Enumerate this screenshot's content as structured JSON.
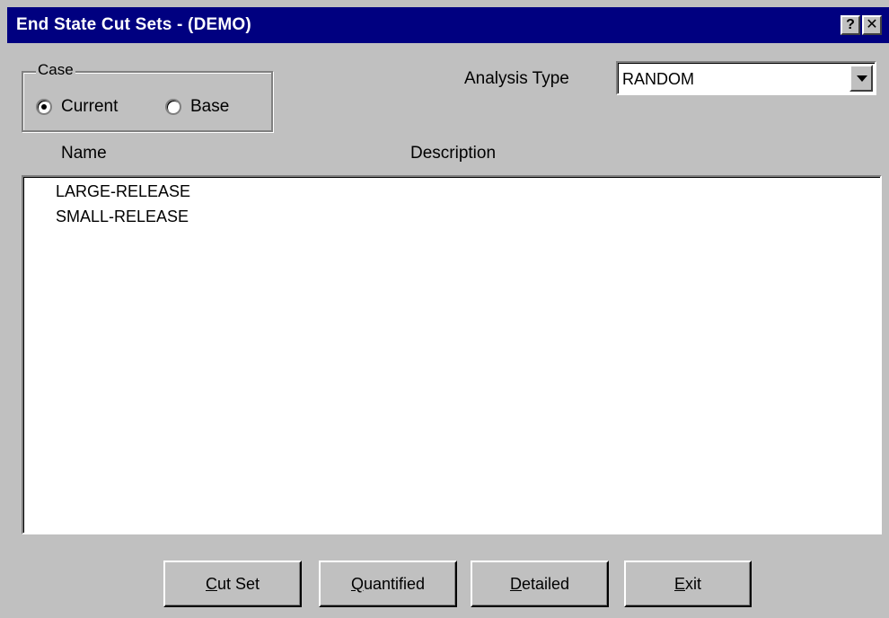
{
  "window": {
    "title": "End State Cut Sets  -  (DEMO)",
    "help_label": "?",
    "close_label": "✕"
  },
  "case_group": {
    "legend": "Case",
    "options": [
      {
        "label": "Current",
        "selected": true
      },
      {
        "label": "Base",
        "selected": false
      }
    ]
  },
  "analysis_type": {
    "label": "Analysis Type",
    "value": "RANDOM"
  },
  "list": {
    "columns": [
      "Name",
      "Description"
    ],
    "items": [
      {
        "name": "LARGE-RELEASE",
        "description": ""
      },
      {
        "name": "SMALL-RELEASE",
        "description": ""
      }
    ]
  },
  "buttons": {
    "cut_set": {
      "mnemonic": "C",
      "rest": "ut Set"
    },
    "quantified": {
      "mnemonic": "Q",
      "rest": "uantified"
    },
    "detailed": {
      "mnemonic": "D",
      "rest": "etailed"
    },
    "exit": {
      "mnemonic": "E",
      "rest": "xit"
    }
  },
  "colors": {
    "titlebar": "#000080",
    "face": "#c0c0c0",
    "list_bg": "#ffffff"
  }
}
